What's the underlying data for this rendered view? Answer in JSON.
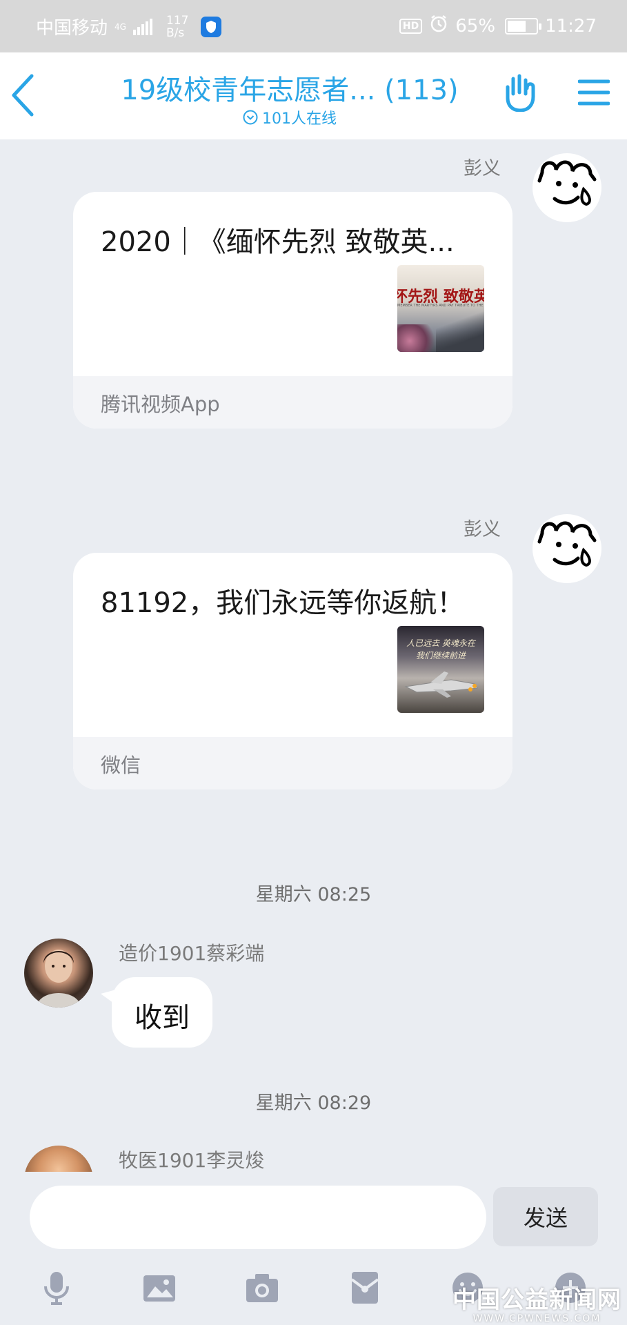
{
  "status_bar": {
    "carrier": "中国移动",
    "network": "4G",
    "speed_value": "117",
    "speed_unit": "B/s",
    "hd_badge": "HD",
    "battery": "65%",
    "battery_level": 0.65,
    "time": "11:27"
  },
  "header": {
    "title": "19级校青年志愿者... (113)",
    "online": "101人在线"
  },
  "messages": [
    {
      "sender": "彭义",
      "title": "2020｜《缅怀先烈 致敬英...",
      "thumb_text": "怀先烈 致敬英",
      "thumb_sub": "MEMBER THE MARTYRS AND PAY TRIBUTE TO THE HEROES",
      "source": "腾讯视频App"
    },
    {
      "sender": "彭义",
      "title": "81192，我们永远等你返航！",
      "thumb_text": "人已远去 英魂永在",
      "thumb_sub": "我们继续前进",
      "source": "微信"
    }
  ],
  "timestamps": [
    "星期六 08:25",
    "星期六 08:29"
  ],
  "chat": [
    {
      "sender": "造价1901蔡彩端",
      "text": "收到"
    },
    {
      "sender": "牧医1901李灵焌"
    }
  ],
  "input": {
    "send_label": "发送"
  },
  "toolbar": [
    "microphone-icon",
    "image-icon",
    "camera-icon",
    "red-packet-icon",
    "emoji-icon",
    "more-icon"
  ],
  "watermark": {
    "line1": "中国公益新闻网",
    "line2": "WWW.CPWNEWS.COM"
  },
  "colors": {
    "accent": "#2aa5e6",
    "background": "#eaedf2",
    "card": "#ffffff"
  }
}
